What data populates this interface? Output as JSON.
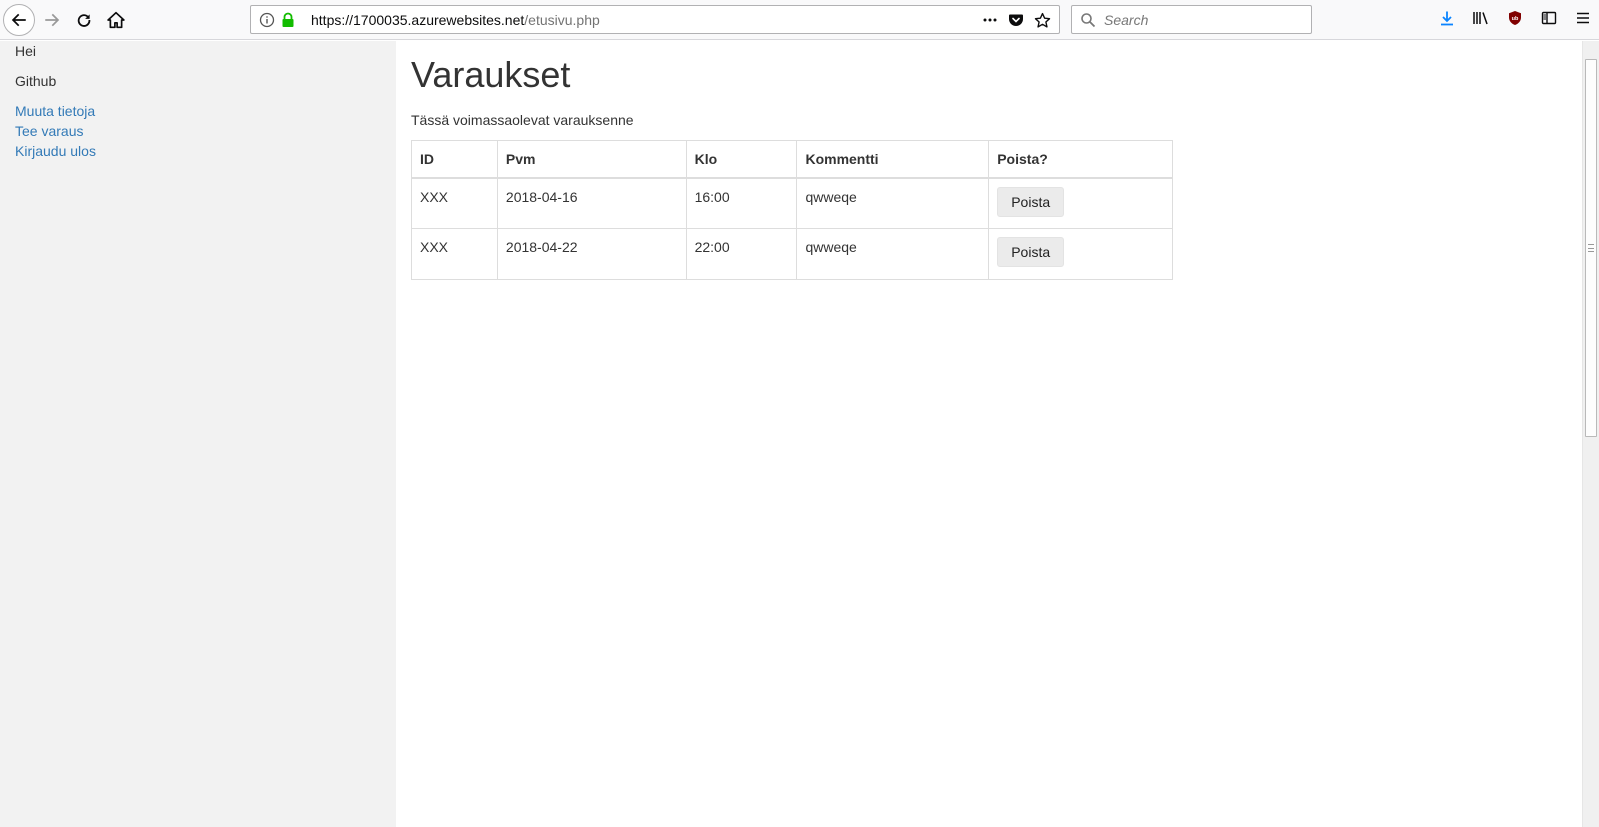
{
  "browser": {
    "url_host": "https://1700035.azurewebsites.net",
    "url_path": "/etusivu.php",
    "search_placeholder": "Search",
    "icons": [
      "back-icon",
      "forward-icon",
      "reload-icon",
      "home-icon",
      "info-icon",
      "lock-icon",
      "more-icon",
      "pocket-icon",
      "bookmark-star-icon",
      "search-icon",
      "download-icon",
      "library-icon",
      "ublock-icon",
      "sidebar-toggle-icon",
      "menu-icon"
    ],
    "colors": {
      "lock": "#12bc00",
      "download": "#0a84ff",
      "ublock": "#800000"
    }
  },
  "sidebar": {
    "greeting": "Hei",
    "github": "Github",
    "links": [
      "Muuta tietoja",
      "Tee varaus",
      "Kirjaudu ulos"
    ],
    "link_color": "#337ab7"
  },
  "main": {
    "title": "Varaukset",
    "lead": "Tässä voimassaolevat varauksenne",
    "table": {
      "headers": [
        "ID",
        "Pvm",
        "Klo",
        "Kommentti",
        "Poista?"
      ],
      "rows": [
        {
          "id": "XXX",
          "pvm": "2018-04-16",
          "klo": "16:00",
          "kommentti": "qwweqe",
          "action": "Poista"
        },
        {
          "id": "XXX",
          "pvm": "2018-04-22",
          "klo": "22:00",
          "kommentti": "qwweqe",
          "action": "Poista"
        }
      ]
    }
  }
}
